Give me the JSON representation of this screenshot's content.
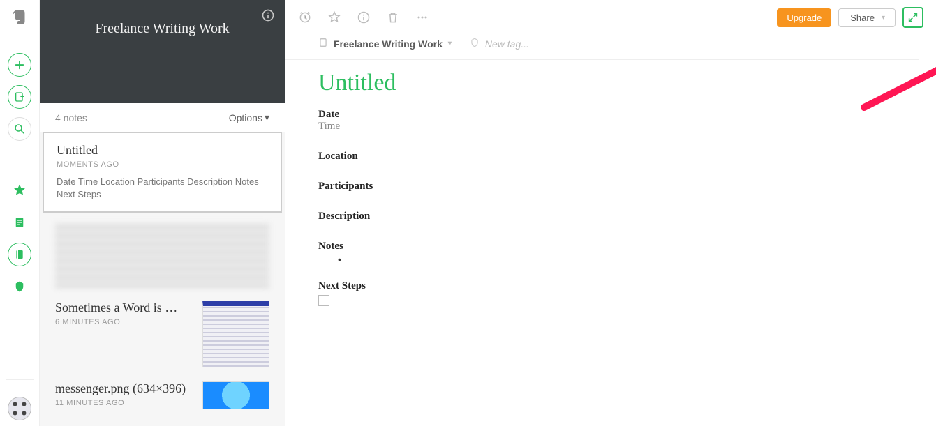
{
  "rail": {
    "logo_name": "evernote-logo"
  },
  "list": {
    "header_title": "Freelance Writing Work",
    "count_label": "4 notes",
    "options_label": "Options",
    "notes": [
      {
        "title": "Untitled",
        "time": "MOMENTS AGO",
        "snippet": "Date Time Location Participants Description Notes Next Steps"
      },
      {
        "title": "Sometimes a Word is …",
        "time": "6 MINUTES AGO",
        "snippet": ""
      },
      {
        "title": "messenger.png (634×396)",
        "time": "11 MINUTES AGO",
        "snippet": ""
      }
    ]
  },
  "toolbar": {
    "upgrade_label": "Upgrade",
    "share_label": "Share"
  },
  "meta": {
    "notebook_label": "Freelance Writing Work",
    "new_tag_placeholder": "New tag..."
  },
  "note": {
    "title": "Untitled",
    "date_label": "Date",
    "time_label": "Time",
    "location_label": "Location",
    "participants_label": "Participants",
    "description_label": "Description",
    "notes_label": "Notes",
    "next_steps_label": "Next Steps"
  }
}
